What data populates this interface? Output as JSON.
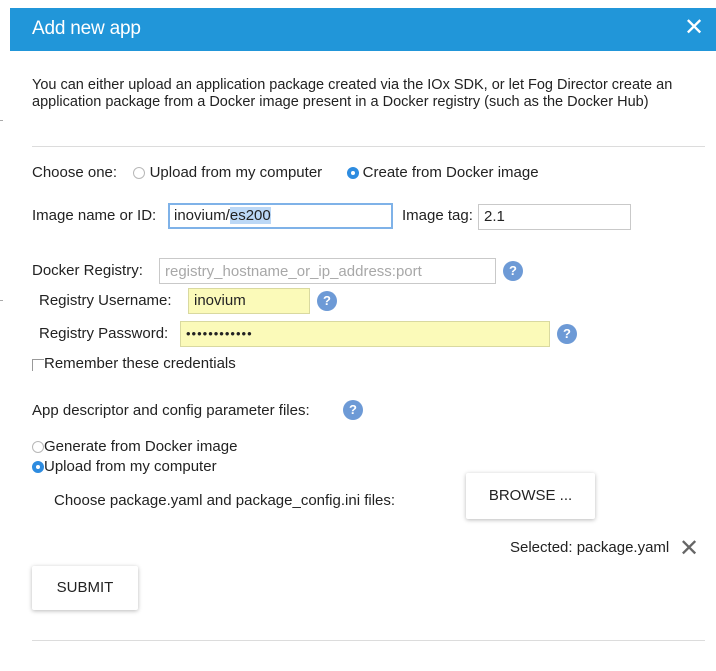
{
  "dialog": {
    "title": "Add new app",
    "close_glyph": "✕",
    "intro": "You can either upload an application package created via the IOx SDK, or let Fog Director create an application package from a Docker image present in a Docker registry (such as the Docker Hub)"
  },
  "source": {
    "label": "Choose one:",
    "options": [
      {
        "label": "Upload from my computer",
        "selected": false
      },
      {
        "label": "Create from Docker image",
        "selected": true
      }
    ]
  },
  "image": {
    "name_label": "Image name or ID:",
    "name_prefix": "inovium/",
    "name_selected": "es200",
    "tag_label": "Image tag:",
    "tag_value": "2.1"
  },
  "registry": {
    "label": "Docker Registry:",
    "placeholder": "registry_hostname_or_ip_address:port",
    "username_label": "Registry Username:",
    "username_value": "inovium",
    "password_label": "Registry Password:",
    "password_value": "••••••••••••",
    "remember_label": "Remember these credentials",
    "help_icon": "?"
  },
  "descriptor": {
    "label": "App descriptor and config parameter files:",
    "options": [
      {
        "label": "Generate from Docker image",
        "selected": false
      },
      {
        "label": "Upload from my computer",
        "selected": true
      }
    ],
    "choose_label": "Choose package.yaml and package_config.ini files:",
    "browse_label": "BROWSE ...",
    "selected_text": "Selected: package.yaml",
    "remove_glyph": "✕"
  },
  "submit_label": "SUBMIT",
  "colors": {
    "titlebar": "#2196d9",
    "help_icon": "#6d9ad6",
    "highlight_field": "#fbfab9",
    "radio_checked": "#2e8ce0"
  }
}
